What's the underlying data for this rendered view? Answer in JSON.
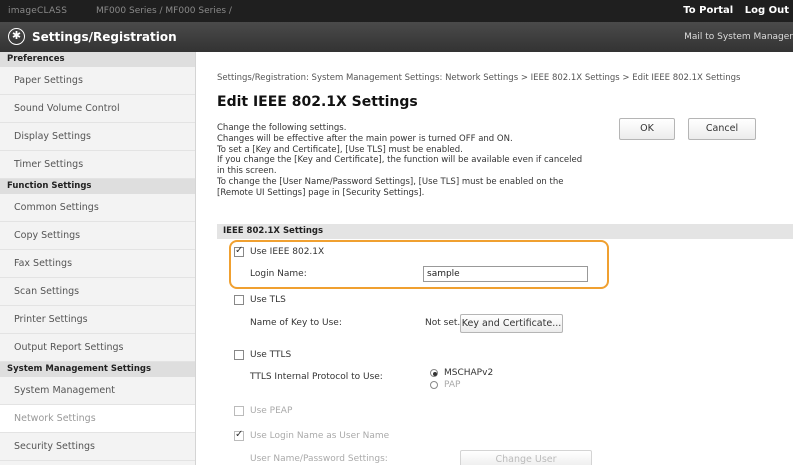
{
  "topbar": {
    "brand": "imageCLASS",
    "crumb": "MF000 Series / MF000 Series /",
    "portal": "To Portal",
    "logout": "Log Out"
  },
  "header": {
    "title": "Settings/Registration",
    "mail": "Mail to System Manager"
  },
  "sidebar": {
    "preferences_title": "Preferences",
    "preferences": [
      "Paper Settings",
      "Sound Volume Control",
      "Display Settings",
      "Timer Settings"
    ],
    "function_title": "Function Settings",
    "functions": [
      "Common Settings",
      "Copy Settings",
      "Fax Settings",
      "Scan Settings",
      "Printer Settings",
      "Output Report Settings"
    ],
    "system_title": "System Management Settings",
    "system": [
      "System Management",
      "Network Settings",
      "Security Settings"
    ]
  },
  "main": {
    "breadcrumb": "Settings/Registration: System Management Settings: Network Settings > IEEE 802.1X Settings > Edit IEEE 802.1X Settings",
    "title": "Edit IEEE 802.1X Settings",
    "desc": [
      "Change the following settings.",
      "Changes will be effective after the main power is turned OFF and ON.",
      "To set a [Key and Certificate], [Use TLS] must be enabled.",
      "If you change the [Key and Certificate], the function will be available even if canceled",
      "in this screen.",
      "To change the [User Name/Password Settings], [Use TLS] must be enabled on the",
      "[Remote UI Settings] page in [Security Settings]."
    ],
    "ok_label": "OK",
    "cancel_label": "Cancel",
    "section_title": "IEEE 802.1X Settings",
    "use_8021x": "Use IEEE 802.1X",
    "login_name_label": "Login Name:",
    "login_name_value": "sample",
    "use_tls": "Use TLS",
    "key_name_label": "Name of Key to Use:",
    "key_name_value": "Not set.",
    "key_button": "Key and Certificate...",
    "use_ttls": "Use TTLS",
    "ttls_protocol_label": "TTLS Internal Protocol to Use:",
    "protocol_options": [
      "MSCHAPv2",
      "PAP"
    ],
    "use_peap": "Use PEAP",
    "use_login_as_user": "Use Login Name as User Name",
    "user_pw_label": "User Name/Password Settings:",
    "user_pw_button": "Change User Name/Password..."
  },
  "colors": {
    "highlight": "#f0a030",
    "header_bg": "#333333",
    "topbar_bg": "#1f1f1f"
  }
}
